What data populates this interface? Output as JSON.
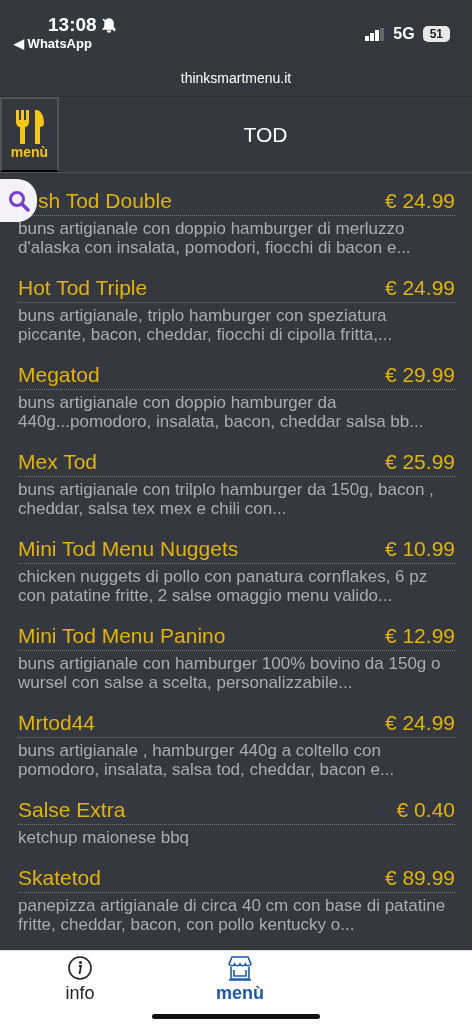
{
  "status_bar": {
    "time": "13:08",
    "back_app": "◀ WhatsApp",
    "network": "5G",
    "battery": "51"
  },
  "url": "thinksmartmenu.it",
  "header": {
    "menu_label": "menù",
    "title": "TOD"
  },
  "items": [
    {
      "name": "sh Tod Double",
      "price": "€ 24.99",
      "description": "buns artigianale con doppio hamburger di merluzzo d'alaska con insalata, pomodori, fiocchi di bacon e..."
    },
    {
      "name": "Hot Tod Triple",
      "price": "€ 24.99",
      "description": "buns artigianale, triplo hamburger con speziatura piccante, bacon, cheddar, fiocchi di cipolla fritta,..."
    },
    {
      "name": "Megatod",
      "price": "€ 29.99",
      "description": "buns artigianale con doppio hamburger da 440g...pomodoro, insalata, bacon, cheddar salsa bb..."
    },
    {
      "name": "Mex Tod",
      "price": "€ 25.99",
      "description": "buns artigianale con trilplo hamburger da 150g, bacon , cheddar, salsa tex mex e chili con..."
    },
    {
      "name": "Mini Tod Menu Nuggets",
      "price": "€ 10.99",
      "description": "chicken nuggets di pollo con panatura cornflakes, 6 pz con patatine fritte, 2 salse omaggio menu valido..."
    },
    {
      "name": "Mini Tod Menu Panino",
      "price": "€ 12.99",
      "description": "buns artigianale con hamburger 100% bovino da 150g o wursel con salse a scelta, personalizzabile..."
    },
    {
      "name": "Mrtod44",
      "price": "€ 24.99",
      "description": "buns artigianale , hamburger 440g a coltello con pomodoro, insalata, salsa tod, cheddar, bacon e..."
    },
    {
      "name": "Salse Extra",
      "price": "€ 0.40",
      "description": "ketchup maionese bbq"
    },
    {
      "name": "Skatetod",
      "price": "€ 89.99",
      "description": "panepizza artigianale di circa 40 cm con base di patatine fritte, cheddar, bacon, con pollo kentucky o..."
    }
  ],
  "bottom_nav": [
    {
      "label": "info",
      "kind": "info",
      "selected": false
    },
    {
      "label": "menù",
      "kind": "shop",
      "selected": true
    }
  ]
}
